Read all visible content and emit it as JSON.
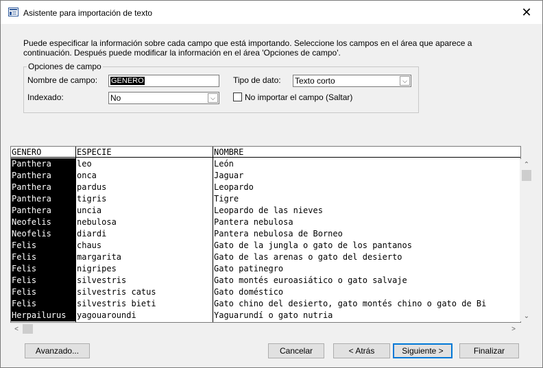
{
  "window": {
    "title": "Asistente para importación de texto",
    "close_glyph": "✕",
    "icon": "import-text-icon"
  },
  "intro_text": "Puede especificar la información sobre cada campo que está importando. Seleccione los campos en el área que aparece a continuación. Después puede modificar la información en el área 'Opciones de campo'.",
  "field_options": {
    "legend": "Opciones de campo",
    "field_name_label": "Nombre de campo:",
    "field_name_value": "GENERO",
    "data_type_label": "Tipo de dato:",
    "data_type_value": "Texto corto",
    "indexed_label": "Indexado:",
    "indexed_value": "No",
    "skip_label": "No importar el campo (Saltar)",
    "skip_checked": false
  },
  "grid": {
    "columns": [
      "GENERO",
      "ESPECIE",
      "NOMBRE"
    ],
    "rows": [
      [
        "Panthera",
        "leo",
        "León"
      ],
      [
        "Panthera",
        "onca",
        "Jaguar"
      ],
      [
        "Panthera",
        "pardus",
        "Leopardo"
      ],
      [
        "Panthera",
        "tigris",
        "Tigre"
      ],
      [
        "Panthera",
        "uncia",
        "Leopardo de las nieves"
      ],
      [
        "Neofelis",
        "nebulosa",
        "Pantera nebulosa"
      ],
      [
        "Neofelis",
        "diardi",
        "Pantera nebulosa de Borneo"
      ],
      [
        "Felis",
        "chaus",
        "Gato de la jungla o gato de los pantanos"
      ],
      [
        "Felis",
        "margarita",
        "Gato de las arenas o gato del desierto"
      ],
      [
        "Felis",
        "nigripes",
        "Gato patinegro"
      ],
      [
        "Felis",
        "silvestris",
        "Gato montés euroasiático o gato salvaje"
      ],
      [
        "Felis",
        "silvestris catus",
        "Gato doméstico"
      ],
      [
        "Felis",
        "silvestris bieti",
        "Gato chino del desierto, gato montés chino o gato de Bi"
      ],
      [
        "Herpailurus",
        "yagouaroundi",
        "Yaguarundí o gato nutria"
      ]
    ]
  },
  "buttons": {
    "advanced": "Avanzado...",
    "cancel": "Cancelar",
    "back": "< Atrás",
    "next": "Siguiente >",
    "finish": "Finalizar"
  }
}
